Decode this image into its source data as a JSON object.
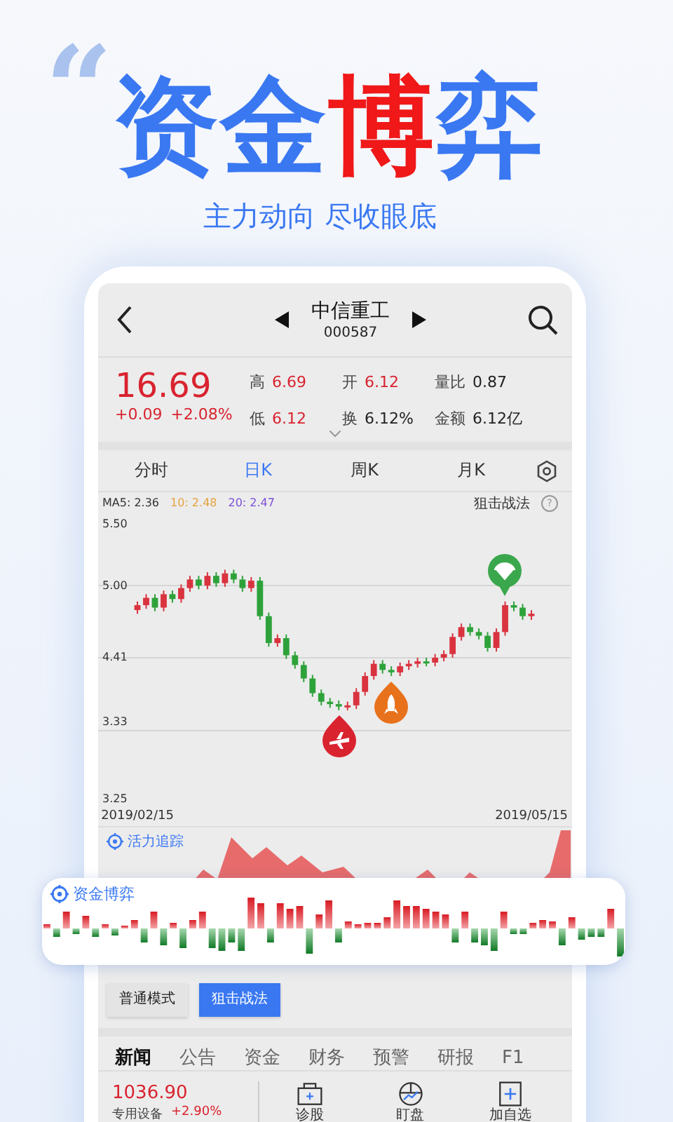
{
  "promo": {
    "quote_mark": "“",
    "headline": [
      {
        "text": "资金",
        "color": "#3a78f2"
      },
      {
        "text": "博",
        "color": "#f01818"
      },
      {
        "text": "弈",
        "color": "#3a78f2"
      }
    ],
    "subtitle": "主力动向 尽收眼底"
  },
  "stock": {
    "name": "中信重工",
    "code": "000587",
    "price": "16.69",
    "change": "+0.09",
    "change_pct": "+2.08%",
    "stats": [
      {
        "label": "高",
        "value": "6.69",
        "color": "#d9232f"
      },
      {
        "label": "开",
        "value": "6.12",
        "color": "#d9232f"
      },
      {
        "label": "量比",
        "value": "0.87",
        "color": "#222222"
      },
      {
        "label": "低",
        "value": "6.12",
        "color": "#d9232f"
      },
      {
        "label": "换",
        "value": "6.12%",
        "color": "#222222"
      },
      {
        "label": "金额",
        "value": "6.12亿",
        "color": "#222222"
      }
    ]
  },
  "period_tabs": [
    {
      "label": "分时",
      "selected": false
    },
    {
      "label": "日K",
      "selected": true
    },
    {
      "label": "周K",
      "selected": false
    },
    {
      "label": "月K",
      "selected": false
    }
  ],
  "ma": [
    {
      "label": "MA5: 2.36",
      "color": "#333333"
    },
    {
      "label": "10: 2.48",
      "color": "#e6a23c"
    },
    {
      "label": "20: 2.47",
      "color": "#7b4fd6"
    }
  ],
  "strategy_label": "狙击战法",
  "help_mark": "?",
  "chart_data": {
    "type": "candlestick",
    "categories": [
      "2019/02/15",
      null,
      null,
      null,
      null,
      null,
      null,
      null,
      null,
      null,
      null,
      null,
      null,
      null,
      null,
      null,
      null,
      null,
      null,
      null,
      null,
      null,
      null,
      null,
      null,
      null,
      null,
      null,
      null,
      null,
      null,
      null,
      null,
      null,
      null,
      null,
      null,
      null,
      null,
      null,
      null,
      null,
      null,
      null,
      null,
      "2019/05/15"
    ],
    "ylim": [
      3.25,
      5.5
    ],
    "ohlc": [
      [
        4.8,
        4.87,
        4.77,
        4.84
      ],
      [
        4.84,
        4.93,
        4.81,
        4.9
      ],
      [
        4.9,
        4.93,
        4.79,
        4.82
      ],
      [
        4.82,
        4.96,
        4.79,
        4.93
      ],
      [
        4.93,
        4.96,
        4.86,
        4.89
      ],
      [
        4.89,
        5.01,
        4.86,
        4.98
      ],
      [
        4.98,
        5.08,
        4.95,
        5.05
      ],
      [
        5.05,
        5.08,
        4.97,
        5.0
      ],
      [
        5.0,
        5.11,
        4.97,
        5.08
      ],
      [
        5.08,
        5.11,
        4.99,
        5.02
      ],
      [
        5.02,
        5.13,
        4.99,
        5.1
      ],
      [
        5.1,
        5.13,
        5.02,
        5.05
      ],
      [
        5.05,
        5.08,
        4.95,
        4.98
      ],
      [
        4.98,
        5.07,
        4.95,
        5.04
      ],
      [
        5.04,
        5.07,
        4.72,
        4.75
      ],
      [
        4.75,
        4.78,
        4.5,
        4.53
      ],
      [
        4.53,
        4.6,
        4.5,
        4.57
      ],
      [
        4.57,
        4.6,
        4.4,
        4.43
      ],
      [
        4.43,
        4.46,
        4.32,
        4.35
      ],
      [
        4.35,
        4.38,
        4.21,
        4.24
      ],
      [
        4.24,
        4.27,
        4.09,
        4.12
      ],
      [
        4.12,
        4.15,
        4.02,
        4.05
      ],
      [
        4.05,
        4.08,
        4.0,
        4.03
      ],
      [
        4.03,
        4.06,
        3.98,
        4.01
      ],
      [
        4.01,
        4.05,
        3.98,
        4.02
      ],
      [
        4.02,
        4.16,
        3.99,
        4.13
      ],
      [
        4.13,
        4.29,
        4.1,
        4.26
      ],
      [
        4.26,
        4.39,
        4.23,
        4.36
      ],
      [
        4.36,
        4.39,
        4.28,
        4.31
      ],
      [
        4.31,
        4.34,
        4.26,
        4.29
      ],
      [
        4.29,
        4.37,
        4.26,
        4.34
      ],
      [
        4.34,
        4.39,
        4.31,
        4.36
      ],
      [
        4.36,
        4.41,
        4.33,
        4.38
      ],
      [
        4.38,
        4.41,
        4.34,
        4.37
      ],
      [
        4.37,
        4.44,
        4.34,
        4.41
      ],
      [
        4.41,
        4.47,
        4.38,
        4.44
      ],
      [
        4.44,
        4.61,
        4.41,
        4.58
      ],
      [
        4.58,
        4.69,
        4.55,
        4.66
      ],
      [
        4.66,
        4.69,
        4.59,
        4.62
      ],
      [
        4.62,
        4.65,
        4.56,
        4.59
      ],
      [
        4.59,
        4.62,
        4.46,
        4.49
      ],
      [
        4.49,
        4.65,
        4.46,
        4.62
      ],
      [
        4.62,
        4.87,
        4.59,
        4.84
      ],
      [
        4.84,
        4.87,
        4.79,
        4.82
      ],
      [
        4.82,
        4.85,
        4.72,
        4.75
      ],
      [
        4.75,
        4.8,
        4.72,
        4.77
      ]
    ],
    "yticks": [
      {
        "value": 5.5,
        "label": "5.50"
      },
      {
        "value": 5.0,
        "label": "5.00"
      },
      {
        "value": 4.41,
        "label": "4.41"
      },
      {
        "value": 3.25,
        "label": "3.25"
      }
    ]
  },
  "chart_grid_label": "3.33",
  "tracker_label": "活力追踪",
  "fund_card_label": "资金博弈",
  "modes": [
    {
      "label": "普通模式",
      "selected": false
    },
    {
      "label": "狙击战法",
      "selected": true
    }
  ],
  "news_tabs": [
    {
      "label": "新闻",
      "selected": true
    },
    {
      "label": "公告",
      "selected": false
    },
    {
      "label": "资金",
      "selected": false
    },
    {
      "label": "财务",
      "selected": false
    },
    {
      "label": "预警",
      "selected": false
    },
    {
      "label": "研报",
      "selected": false
    },
    {
      "label": "F1",
      "selected": false
    }
  ],
  "bottom": {
    "index_value": "1036.90",
    "sector": "专用设备",
    "sector_change": "+2.90%",
    "actions": [
      {
        "label": "诊股",
        "kind": "diagnose"
      },
      {
        "label": "盯盘",
        "kind": "watch"
      },
      {
        "label": "加自选",
        "kind": "add"
      }
    ]
  }
}
